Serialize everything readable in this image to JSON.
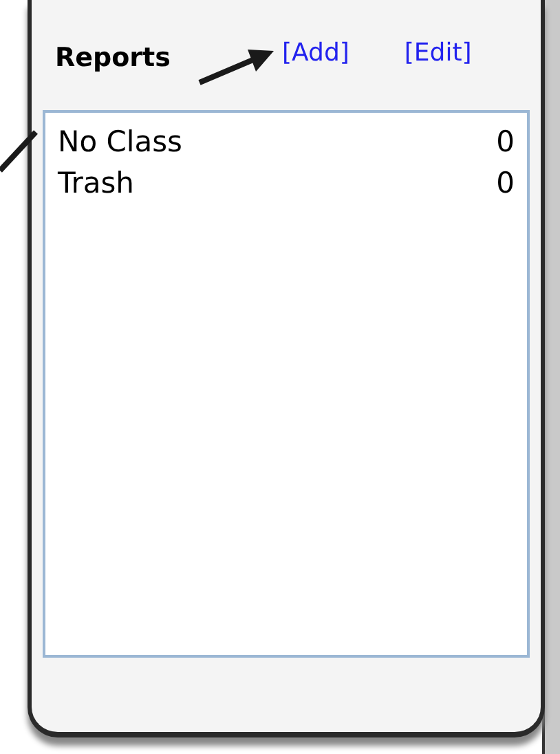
{
  "panel": {
    "title": "Reports",
    "links": [
      {
        "label": "[Add]"
      },
      {
        "label": "[Edit]"
      }
    ]
  },
  "list": {
    "rows": [
      {
        "name": "No Class",
        "count": "0"
      },
      {
        "name": "Trash",
        "count": "0"
      }
    ]
  }
}
